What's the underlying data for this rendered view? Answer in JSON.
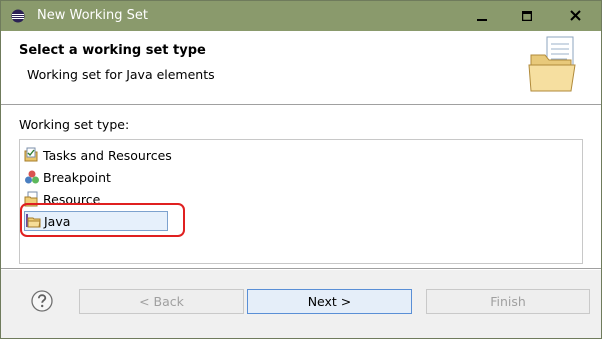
{
  "window": {
    "title": "New Working Set"
  },
  "header": {
    "title": "Select a working set type",
    "description": "Working set for Java elements"
  },
  "body": {
    "label": "Working set type:",
    "items": [
      {
        "label": "Tasks and Resources",
        "icon": "tasks-resources-icon"
      },
      {
        "label": "Breakpoint",
        "icon": "breakpoint-icon"
      },
      {
        "label": "Resource",
        "icon": "resource-icon"
      },
      {
        "label": "Java",
        "icon": "java-folder-icon",
        "selected": true
      }
    ]
  },
  "footer": {
    "back_label": "< Back",
    "next_label": "Next >",
    "finish_label": "Finish"
  },
  "colors": {
    "titlebar": "#8a9a6c",
    "highlight": "#e02020",
    "selection": "#e6f0fb"
  }
}
